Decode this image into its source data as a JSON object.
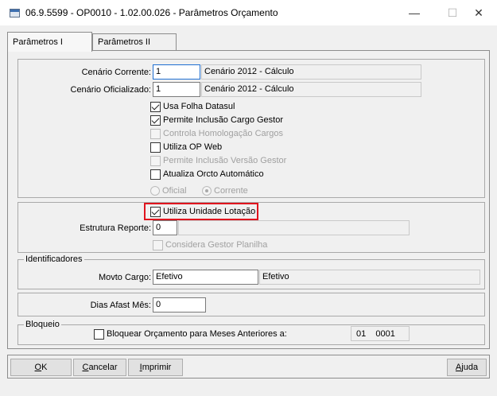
{
  "window": {
    "title": "06.9.5599 - OP0010 - 1.02.00.026 - Parâmetros Orçamento",
    "minimize_glyph": "—",
    "maximize_glyph": "☐",
    "close_glyph": "✕"
  },
  "tabs": [
    {
      "label": "Parâmetros I",
      "active": true
    },
    {
      "label": "Parâmetros II",
      "active": false
    }
  ],
  "group_main": {
    "cenario_corrente": {
      "label": "Cenário Corrente:",
      "value": "1",
      "description": "Cenário 2012 - Cálculo"
    },
    "cenario_oficializado": {
      "label": "Cenário Oficializado:",
      "value": "1",
      "description": "Cenário 2012 - Cálculo"
    },
    "checkboxes": [
      {
        "label": "Usa Folha Datasul",
        "checked": true,
        "enabled": true
      },
      {
        "label": "Permite Inclusão Cargo Gestor",
        "checked": true,
        "enabled": true
      },
      {
        "label": "Controla Homologação Cargos",
        "checked": false,
        "enabled": false
      },
      {
        "label": "Utiliza OP Web",
        "checked": false,
        "enabled": true
      },
      {
        "label": "Permite Inclusão Versão Gestor",
        "checked": false,
        "enabled": false
      },
      {
        "label": "Atualiza Orcto Automático",
        "checked": false,
        "enabled": true
      }
    ],
    "radios": [
      {
        "label": "Oficial",
        "selected": false
      },
      {
        "label": "Corrente",
        "selected": true
      }
    ]
  },
  "group_lotacao": {
    "utiliza_unidade_lotacao": {
      "label": "Utiliza Unidade Lotação",
      "checked": true
    },
    "estrutura_reporte": {
      "label": "Estrutura Reporte:",
      "value": "0",
      "description": ""
    },
    "considera_gestor": {
      "label": "Considera Gestor  Planilha",
      "checked": false,
      "enabled": false
    }
  },
  "group_identificadores": {
    "title": "Identificadores",
    "movto_cargo": {
      "label": "Movto Cargo:",
      "value": "Efetivo",
      "description": "Efetivo"
    }
  },
  "group_afast": {
    "dias_afast": {
      "label": "Dias Afast Mês:",
      "value": "0"
    }
  },
  "group_bloqueio": {
    "title": "Bloqueio",
    "bloquear": {
      "label": "Bloquear Orçamento para Meses Anteriores a:",
      "checked": false
    },
    "month": "01",
    "year": "0001"
  },
  "buttons": {
    "ok": {
      "underline": "O",
      "rest": "K"
    },
    "cancelar": {
      "underline": "C",
      "rest": "ancelar"
    },
    "imprimir": {
      "underline": "I",
      "rest": "mprimir"
    },
    "ajuda": {
      "underline": "A",
      "rest": "juda"
    }
  },
  "colors": {
    "highlight": "#e0141e",
    "focus_border": "#1f6fd1"
  }
}
